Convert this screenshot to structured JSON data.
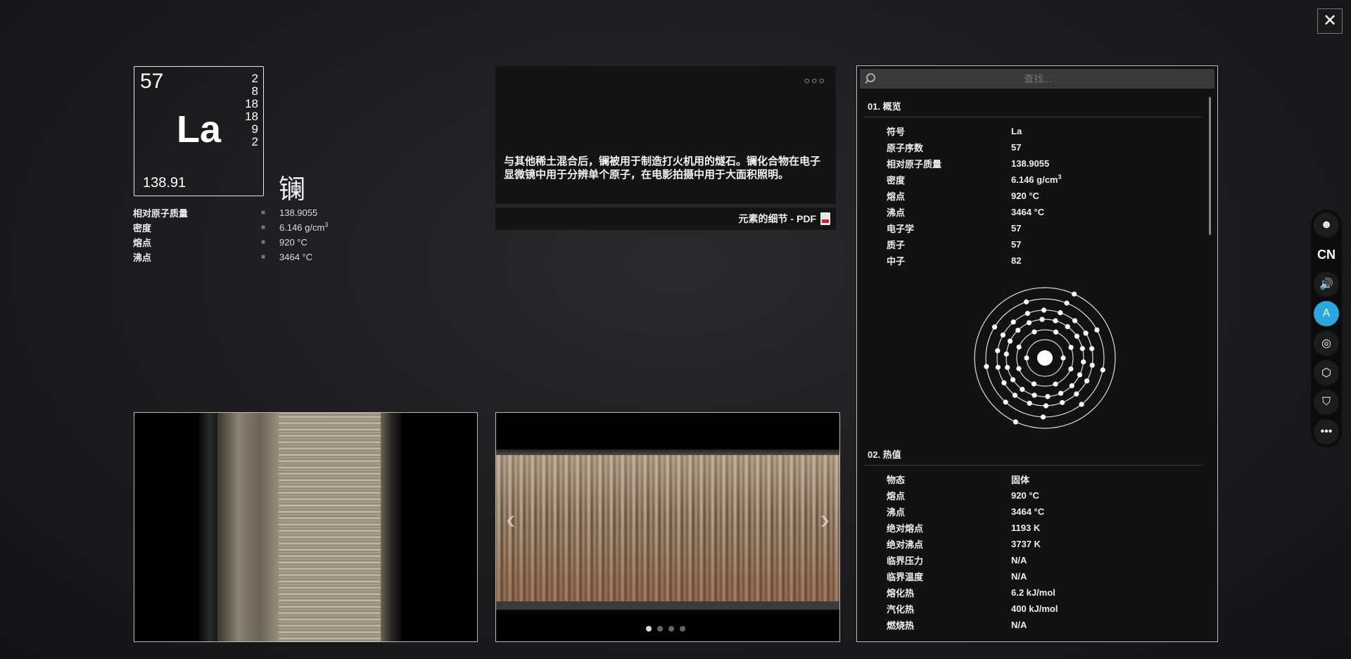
{
  "close_label": "✕",
  "element": {
    "atomic_number": "57",
    "symbol": "La",
    "atomic_mass": "138.91",
    "shells": [
      "2",
      "8",
      "18",
      "18",
      "9",
      "2"
    ],
    "chinese_name": "镧"
  },
  "summary_props": [
    {
      "key": "相对原子质量",
      "value": "138.9055",
      "sup": ""
    },
    {
      "key": "密度",
      "value": "6.146 g/cm",
      "sup": "3"
    },
    {
      "key": "熔点",
      "value": "920 °C",
      "sup": ""
    },
    {
      "key": "沸点",
      "value": "3464 °C",
      "sup": ""
    }
  ],
  "description": {
    "more_label": "○○○",
    "text": "与其他稀土混合后，镧被用于制造打火机用的燧石。镧化合物在电子显微镜中用于分辨单个原子，在电影拍摄中用于大面积照明。",
    "pdf_label": "元素的细节 - PDF"
  },
  "carousel": {
    "prev": "‹",
    "next": "›",
    "dot_count": 4,
    "active_index": 0
  },
  "panel": {
    "search_placeholder": "查找...",
    "overview": {
      "title": "01. 概览",
      "rows": [
        {
          "k": "符号",
          "v": "La",
          "sup": ""
        },
        {
          "k": "原子序数",
          "v": "57",
          "sup": ""
        },
        {
          "k": "相对原子质量",
          "v": "138.9055",
          "sup": ""
        },
        {
          "k": "密度",
          "v": "6.146 g/cm",
          "sup": "3"
        },
        {
          "k": "熔点",
          "v": "920 °C",
          "sup": ""
        },
        {
          "k": "沸点",
          "v": "3464 °C",
          "sup": ""
        },
        {
          "k": "电子学",
          "v": "57",
          "sup": ""
        },
        {
          "k": "质子",
          "v": "57",
          "sup": ""
        },
        {
          "k": "中子",
          "v": "82",
          "sup": ""
        }
      ]
    },
    "thermal": {
      "title": "02. 热值",
      "rows": [
        {
          "k": "物态",
          "v": "固体",
          "sup": ""
        },
        {
          "k": "熔点",
          "v": "920 °C",
          "sup": ""
        },
        {
          "k": "沸点",
          "v": "3464 °C",
          "sup": ""
        },
        {
          "k": "绝对熔点",
          "v": "1193 K",
          "sup": ""
        },
        {
          "k": "绝对沸点",
          "v": "3737 K",
          "sup": ""
        },
        {
          "k": "临界压力",
          "v": "N/A",
          "sup": ""
        },
        {
          "k": "临界温度",
          "v": "N/A",
          "sup": ""
        },
        {
          "k": "熔化热",
          "v": "6.2 kJ/mol",
          "sup": ""
        },
        {
          "k": "汽化热",
          "v": "400 kJ/mol",
          "sup": ""
        },
        {
          "k": "燃烧热",
          "v": "N/A",
          "sup": ""
        }
      ]
    }
  },
  "toolbar": {
    "items": [
      {
        "name": "avatar-icon",
        "glyph": "☻",
        "active": false
      },
      {
        "name": "language-button",
        "glyph": "CN",
        "active": false
      },
      {
        "name": "sound-icon",
        "glyph": "🔊",
        "active": false
      },
      {
        "name": "app-store-icon",
        "glyph": "A",
        "active": true
      },
      {
        "name": "spiral-icon",
        "glyph": "◎",
        "active": false
      },
      {
        "name": "cube-icon",
        "glyph": "⬡",
        "active": false
      },
      {
        "name": "shield-icon",
        "glyph": "⛉",
        "active": false
      },
      {
        "name": "more-icon",
        "glyph": "•••",
        "active": false
      }
    ]
  },
  "colors": {
    "accent": "#29a8e0",
    "background": "#1c1c1e"
  }
}
